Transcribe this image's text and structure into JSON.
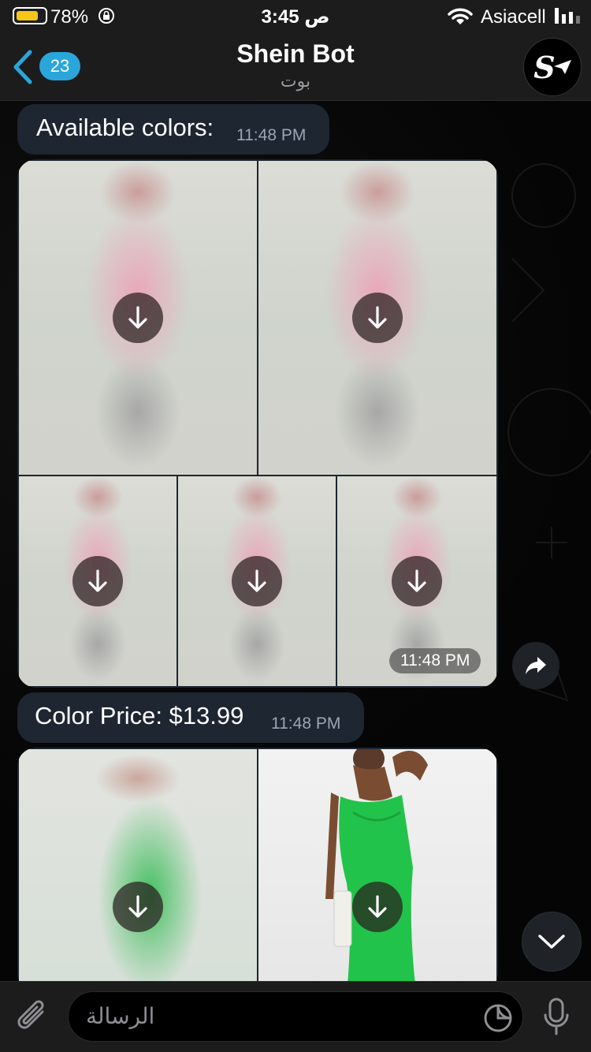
{
  "status_bar": {
    "battery_pct": "78%",
    "battery_level": 0.78,
    "time": "3:45 ص",
    "carrier": "Asiacell"
  },
  "header": {
    "back_badge": "23",
    "title": "Shein Bot",
    "subtitle": "بوت",
    "avatar_letter": "S"
  },
  "messages": [
    {
      "text": "Available colors:",
      "time": "11:48 PM"
    },
    {
      "album_time": "11:48 PM"
    },
    {
      "text": "Color Price: $13.99",
      "time": "11:48 PM"
    }
  ],
  "input": {
    "placeholder": "الرسالة"
  },
  "colors": {
    "bubble": "#1d2631",
    "badge": "#2aa6db",
    "dress_green": "#22c34a",
    "dress_pink": "#eaa6bb"
  },
  "icons": [
    "back-chevron-icon",
    "lock-rotation-icon",
    "wifi-icon",
    "signal-icon",
    "download-icon",
    "forward-icon",
    "chevron-down-icon",
    "paperclip-icon",
    "sticker-icon",
    "microphone-icon"
  ]
}
